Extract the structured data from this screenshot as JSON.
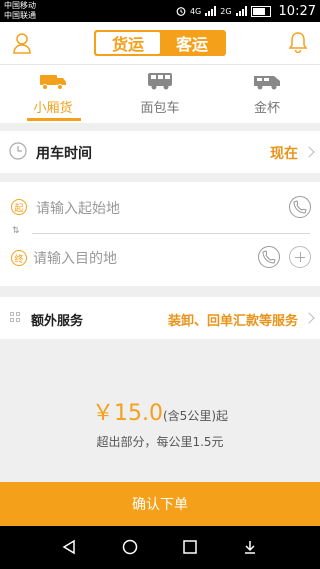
{
  "status": {
    "carrier1": "中国移动",
    "carrier2": "中国联通",
    "net1": "4G",
    "net2": "2G",
    "time": "10:27"
  },
  "header": {
    "tabs": [
      "货运",
      "客运"
    ],
    "active_tab": "货运",
    "left_icon": "user-icon",
    "right_icon": "bell-icon"
  },
  "vehicles": [
    {
      "label": "小厢货",
      "active": true,
      "icon": "small-truck-icon"
    },
    {
      "label": "面包车",
      "active": false,
      "icon": "van-icon"
    },
    {
      "label": "金杯",
      "active": false,
      "icon": "minibus-icon"
    }
  ],
  "time_row": {
    "label": "用车时间",
    "value": "现在"
  },
  "address": {
    "start_badge": "起",
    "start_placeholder": "请输入起始地",
    "end_badge": "终",
    "end_placeholder": "请输入目的地"
  },
  "extra": {
    "label": "额外服务",
    "value": "装卸、回单汇款等服务"
  },
  "price": {
    "amount": "￥15.0",
    "note": "(含5公里)起",
    "sub": "超出部分，每公里1.5元"
  },
  "confirm_label": "确认下单",
  "colors": {
    "accent": "#f5a01a"
  }
}
